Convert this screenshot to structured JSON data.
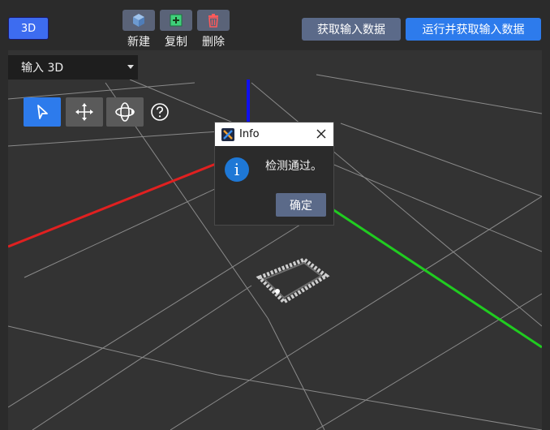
{
  "toolbar": {
    "mode_label": "3D",
    "new_label": "新建",
    "copy_label": "复制",
    "delete_label": "删除",
    "get_input_label": "获取输入数据",
    "run_get_input_label": "运行并获取输入数据"
  },
  "viewport": {
    "input_select_value": "输入 3D",
    "tools": [
      "pointer-select-icon",
      "move-arrows-icon",
      "orbit-rotate-icon",
      "help-icon"
    ],
    "axis_colors": {
      "x": "#e02020",
      "y": "#20cc20",
      "z": "#1010ee"
    }
  },
  "dialog": {
    "title": "Info",
    "message": "检测通过。",
    "ok_label": "确定"
  },
  "colors": {
    "accent": "#2d7bec",
    "secondary_button": "#5b6a89",
    "background": "#2b2b2b",
    "viewport": "#333333"
  }
}
